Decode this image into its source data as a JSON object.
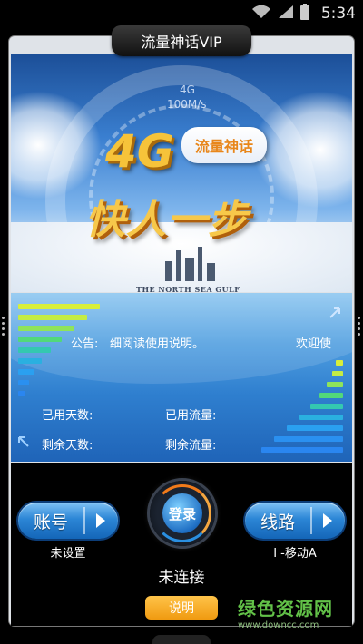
{
  "status_bar": {
    "time": "5:34",
    "icons": [
      "wifi-icon",
      "signal-icon",
      "battery-icon"
    ]
  },
  "app": {
    "title": "流量神话VIP"
  },
  "banner": {
    "speed_label": "4G",
    "speed_unit": "100M/s",
    "headline": "4G",
    "bubble": "流量神话",
    "slogan": "快人一步",
    "caption": "THE NORTH SEA GULF"
  },
  "panel": {
    "notice_label": "公告:",
    "notice_text": "细阅读使用说明。",
    "welcome_text": "欢迎使",
    "used_days_label": "已用天数:",
    "used_traffic_label": "已用流量:",
    "remaining_days_label": "剩余天数:",
    "remaining_traffic_label": "剩余流量:"
  },
  "controls": {
    "account_label": "账号",
    "account_status": "未设置",
    "login_label": "登录",
    "connection_status": "未连接",
    "route_label": "线路",
    "route_value": "I -移动A",
    "help_label": "说明"
  },
  "watermark": {
    "title": "绿色资源网",
    "url": "www.downcc.com"
  },
  "colors": {
    "accent_blue": "#2c86d6",
    "help_orange": "#f09a10",
    "watermark_green": "#62c148"
  }
}
